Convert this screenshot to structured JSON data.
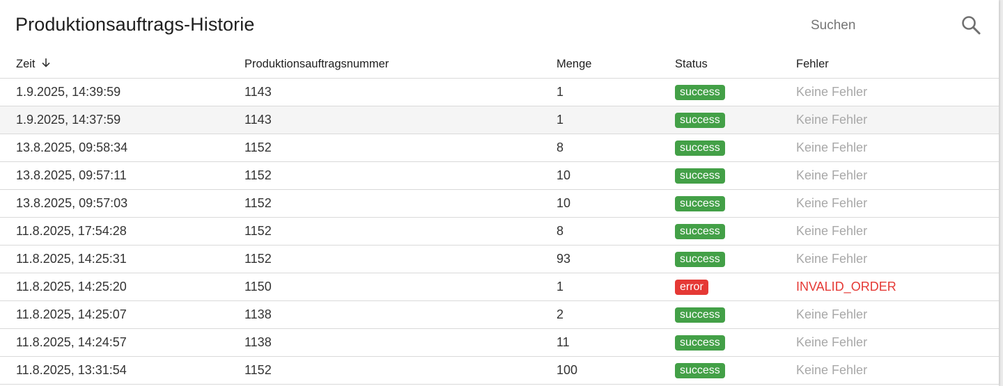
{
  "header": {
    "title": "Produktionsauftrags-Historie",
    "search_placeholder": "Suchen",
    "search_value": ""
  },
  "table": {
    "columns": {
      "time": "Zeit",
      "order_number": "Produktionsauftragsnummer",
      "quantity": "Menge",
      "status": "Status",
      "error": "Fehler"
    },
    "sort": {
      "column": "Zeit",
      "direction": "descending"
    },
    "rows": [
      {
        "time": "1.9.2025, 14:39:59",
        "order": "1143",
        "qty": "1",
        "status": "success",
        "error": "Keine Fehler"
      },
      {
        "time": "1.9.2025, 14:37:59",
        "order": "1143",
        "qty": "1",
        "status": "success",
        "error": "Keine Fehler"
      },
      {
        "time": "13.8.2025, 09:58:34",
        "order": "1152",
        "qty": "8",
        "status": "success",
        "error": "Keine Fehler"
      },
      {
        "time": "13.8.2025, 09:57:11",
        "order": "1152",
        "qty": "10",
        "status": "success",
        "error": "Keine Fehler"
      },
      {
        "time": "13.8.2025, 09:57:03",
        "order": "1152",
        "qty": "10",
        "status": "success",
        "error": "Keine Fehler"
      },
      {
        "time": "11.8.2025, 17:54:28",
        "order": "1152",
        "qty": "8",
        "status": "success",
        "error": "Keine Fehler"
      },
      {
        "time": "11.8.2025, 14:25:31",
        "order": "1152",
        "qty": "93",
        "status": "success",
        "error": "Keine Fehler"
      },
      {
        "time": "11.8.2025, 14:25:20",
        "order": "1150",
        "qty": "1",
        "status": "error",
        "error": "INVALID_ORDER"
      },
      {
        "time": "11.8.2025, 14:25:07",
        "order": "1138",
        "qty": "2",
        "status": "success",
        "error": "Keine Fehler"
      },
      {
        "time": "11.8.2025, 14:24:57",
        "order": "1138",
        "qty": "11",
        "status": "success",
        "error": "Keine Fehler"
      },
      {
        "time": "11.8.2025, 13:31:54",
        "order": "1152",
        "qty": "100",
        "status": "success",
        "error": "Keine Fehler"
      }
    ]
  },
  "colors": {
    "success": "#43a047",
    "error": "#e53935",
    "muted_text": "#a8a8a8",
    "row_highlight": "#f5f5f5"
  },
  "icons": {
    "sort": "arrow-down-icon",
    "search": "search-icon"
  }
}
